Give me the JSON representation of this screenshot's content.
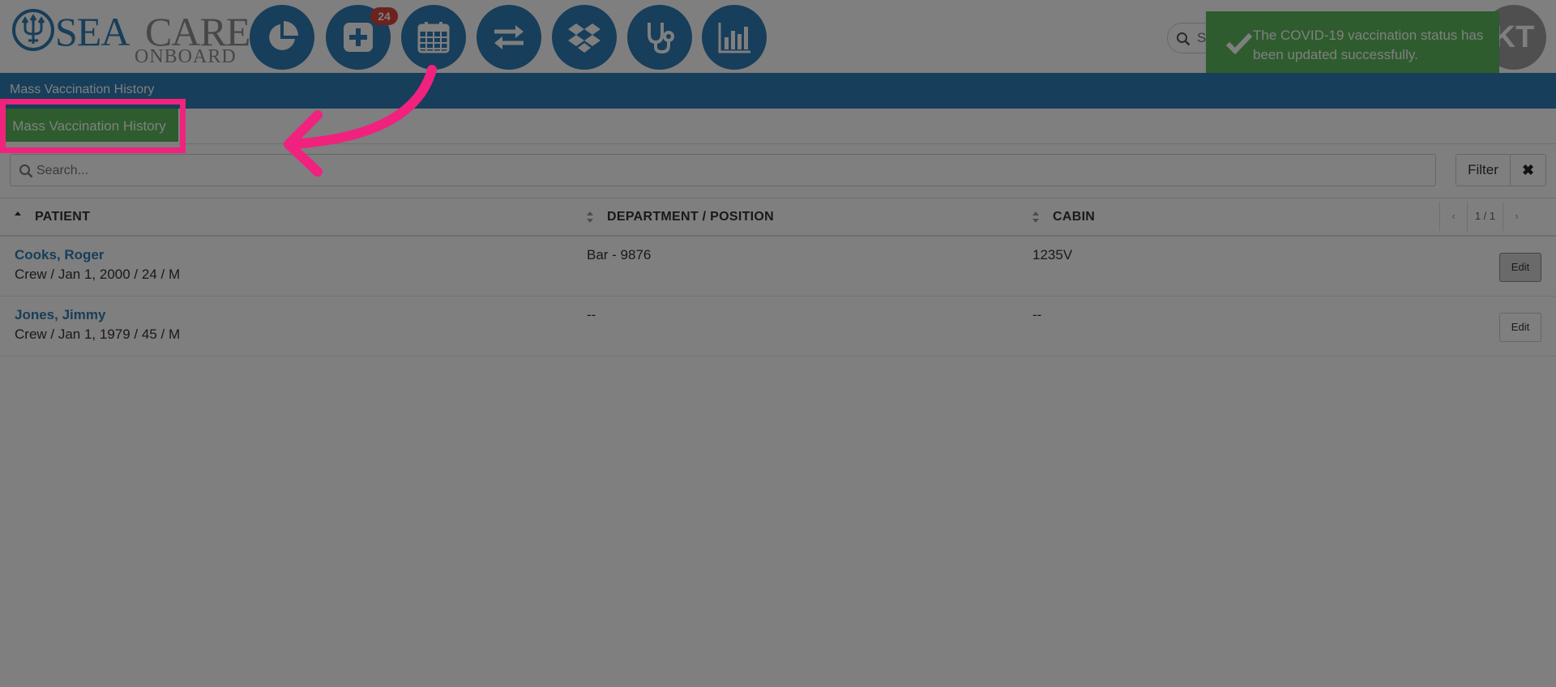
{
  "header": {
    "logo": {
      "sea": "SEA",
      "care": "CARE",
      "onboard": "ONBOARD"
    },
    "nav_icons": [
      "pie-chart-icon",
      "plus-square-icon",
      "calendar-icon",
      "exchange-icon",
      "dropbox-icon",
      "stethoscope-icon",
      "bar-chart-icon"
    ],
    "badge_count": "24",
    "search": {
      "placeholder": "Search patients"
    },
    "avatar_initials": "KT",
    "toast": {
      "message": "The COVID-19 vaccination status has been updated successfully."
    }
  },
  "breadcrumb": {
    "title": "Mass Vaccination History"
  },
  "tabs": [
    {
      "label": "Mass Vaccination History",
      "active": true
    }
  ],
  "list": {
    "search_placeholder": "Search...",
    "filter_label": "Filter",
    "clear_label": "✖",
    "columns": [
      "PATIENT",
      "DEPARTMENT / POSITION",
      "CABIN"
    ],
    "pagination": {
      "prev": "‹",
      "page": "1 / 1",
      "next": "›"
    },
    "rows": [
      {
        "name": "Cooks, Roger",
        "details": "Crew / Jan 1, 2000 / 24 / M",
        "department": "Bar - 9876",
        "cabin": "1235V",
        "action": "Edit"
      },
      {
        "name": "Jones, Jimmy",
        "details": "Crew / Jan 1, 1979 / 45 / M",
        "department": "--",
        "cabin": "--",
        "action": "Edit"
      }
    ]
  },
  "colors": {
    "primary_blue": "#2f7db5",
    "success_green": "#5cb85c",
    "badge_red": "#d9453b",
    "highlight_pink": "#f0227e"
  }
}
